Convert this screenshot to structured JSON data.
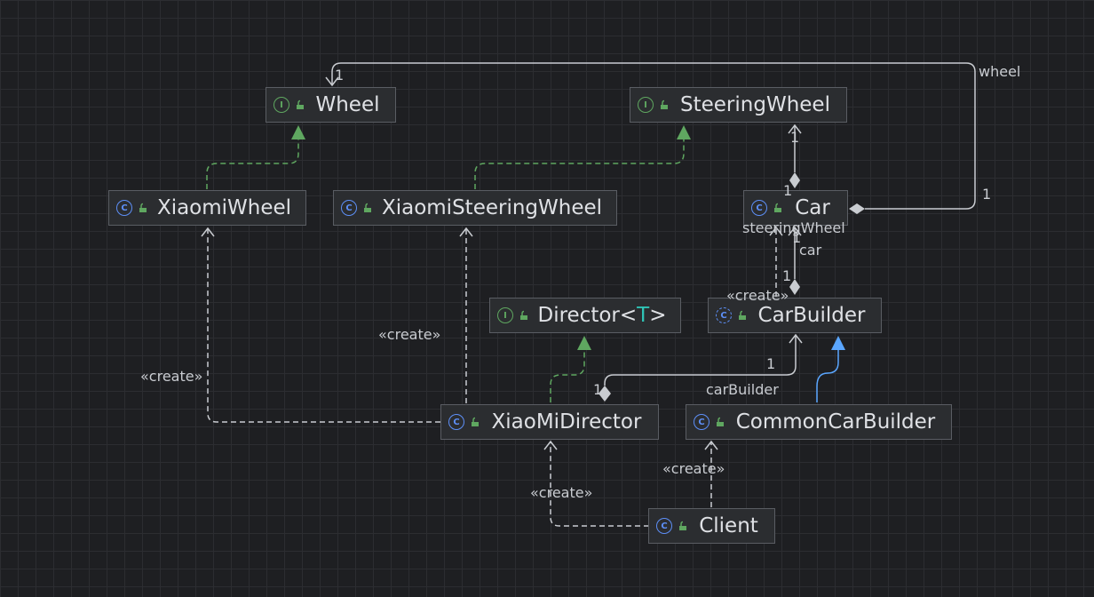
{
  "nodes": {
    "wheel": {
      "name": "Wheel",
      "kind": "I"
    },
    "steering_wheel": {
      "name": "SteeringWheel",
      "kind": "I"
    },
    "xiaomi_wheel": {
      "name": "XiaomiWheel",
      "kind": "C"
    },
    "xiaomi_steering_wheel": {
      "name": "XiaomiSteeringWheel",
      "kind": "C"
    },
    "car": {
      "name": "Car",
      "kind": "C"
    },
    "director": {
      "name": "Director",
      "type_open": "<",
      "type_param": "T",
      "type_close": ">",
      "kind": "I"
    },
    "car_builder": {
      "name": "CarBuilder",
      "kind": "C"
    },
    "xiaomi_director": {
      "name": "XiaoMiDirector",
      "kind": "C"
    },
    "common_car_builder": {
      "name": "CommonCarBuilder",
      "kind": "C"
    },
    "client": {
      "name": "Client",
      "kind": "C"
    }
  },
  "labels": {
    "wheel_role": "wheel",
    "wheel_mult_target": "1",
    "wheel_mult_source": "1",
    "steering_mult_target": "1",
    "steering_mult_source": "1",
    "steering_role": "steeringWheel",
    "car_role": "car",
    "car_mult_target": "1",
    "car_mult_source": "1",
    "car_create": "«create»",
    "car_builder_mult": "1",
    "car_builder_role": "carBuilder",
    "car_builder_source_mult": "1",
    "create_xsw": "«create»",
    "create_xw": "«create»",
    "create_director": "«create»",
    "create_ccb": "«create»"
  },
  "colors": {
    "realization": "#5fa760",
    "generalization": "#5aa6ff",
    "association": "#c9ccd1",
    "dependency": "#c9ccd1"
  }
}
